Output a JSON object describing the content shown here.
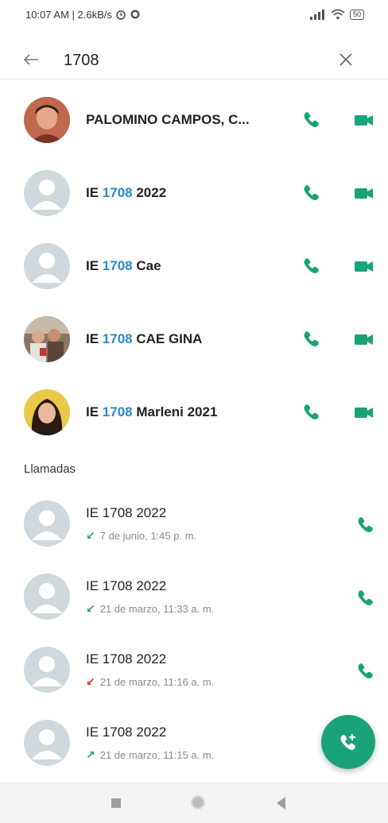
{
  "status_bar": {
    "time_speed": "10:07 AM | 2.6kB/s",
    "battery": "50"
  },
  "search": {
    "query": "1708"
  },
  "contacts": [
    {
      "prefix": "",
      "match": "",
      "suffix": "PALOMINO CAMPOS, C...",
      "avatar": "photo-woman-red"
    },
    {
      "prefix": "IE ",
      "match": "1708",
      "suffix": " 2022",
      "avatar": "default"
    },
    {
      "prefix": "IE ",
      "match": "1708",
      "suffix": " Cae",
      "avatar": "default"
    },
    {
      "prefix": "IE ",
      "match": "1708",
      "suffix": " CAE GINA",
      "avatar": "photo-group"
    },
    {
      "prefix": "IE ",
      "match": "1708",
      "suffix": " Marleni 2021",
      "avatar": "photo-woman-dark"
    }
  ],
  "calls_section": {
    "title": "Llamadas"
  },
  "calls": [
    {
      "name": "IE 1708 2022",
      "direction": "incoming",
      "arrow": "↙",
      "when": "7 de junio, 1:45 p. m."
    },
    {
      "name": "IE 1708 2022",
      "direction": "incoming",
      "arrow": "↙",
      "when": "21 de marzo, 11:33 a. m."
    },
    {
      "name": "IE 1708 2022",
      "direction": "missed",
      "arrow": "↙",
      "when": "21 de marzo, 11:16 a. m."
    },
    {
      "name": "IE 1708 2022",
      "direction": "outgoing",
      "arrow": "↗",
      "when": "21 de marzo, 11:15 a. m."
    }
  ],
  "colors": {
    "accent": "#1aa378",
    "highlight": "#2b88c9",
    "missed": "#d32f2f"
  }
}
